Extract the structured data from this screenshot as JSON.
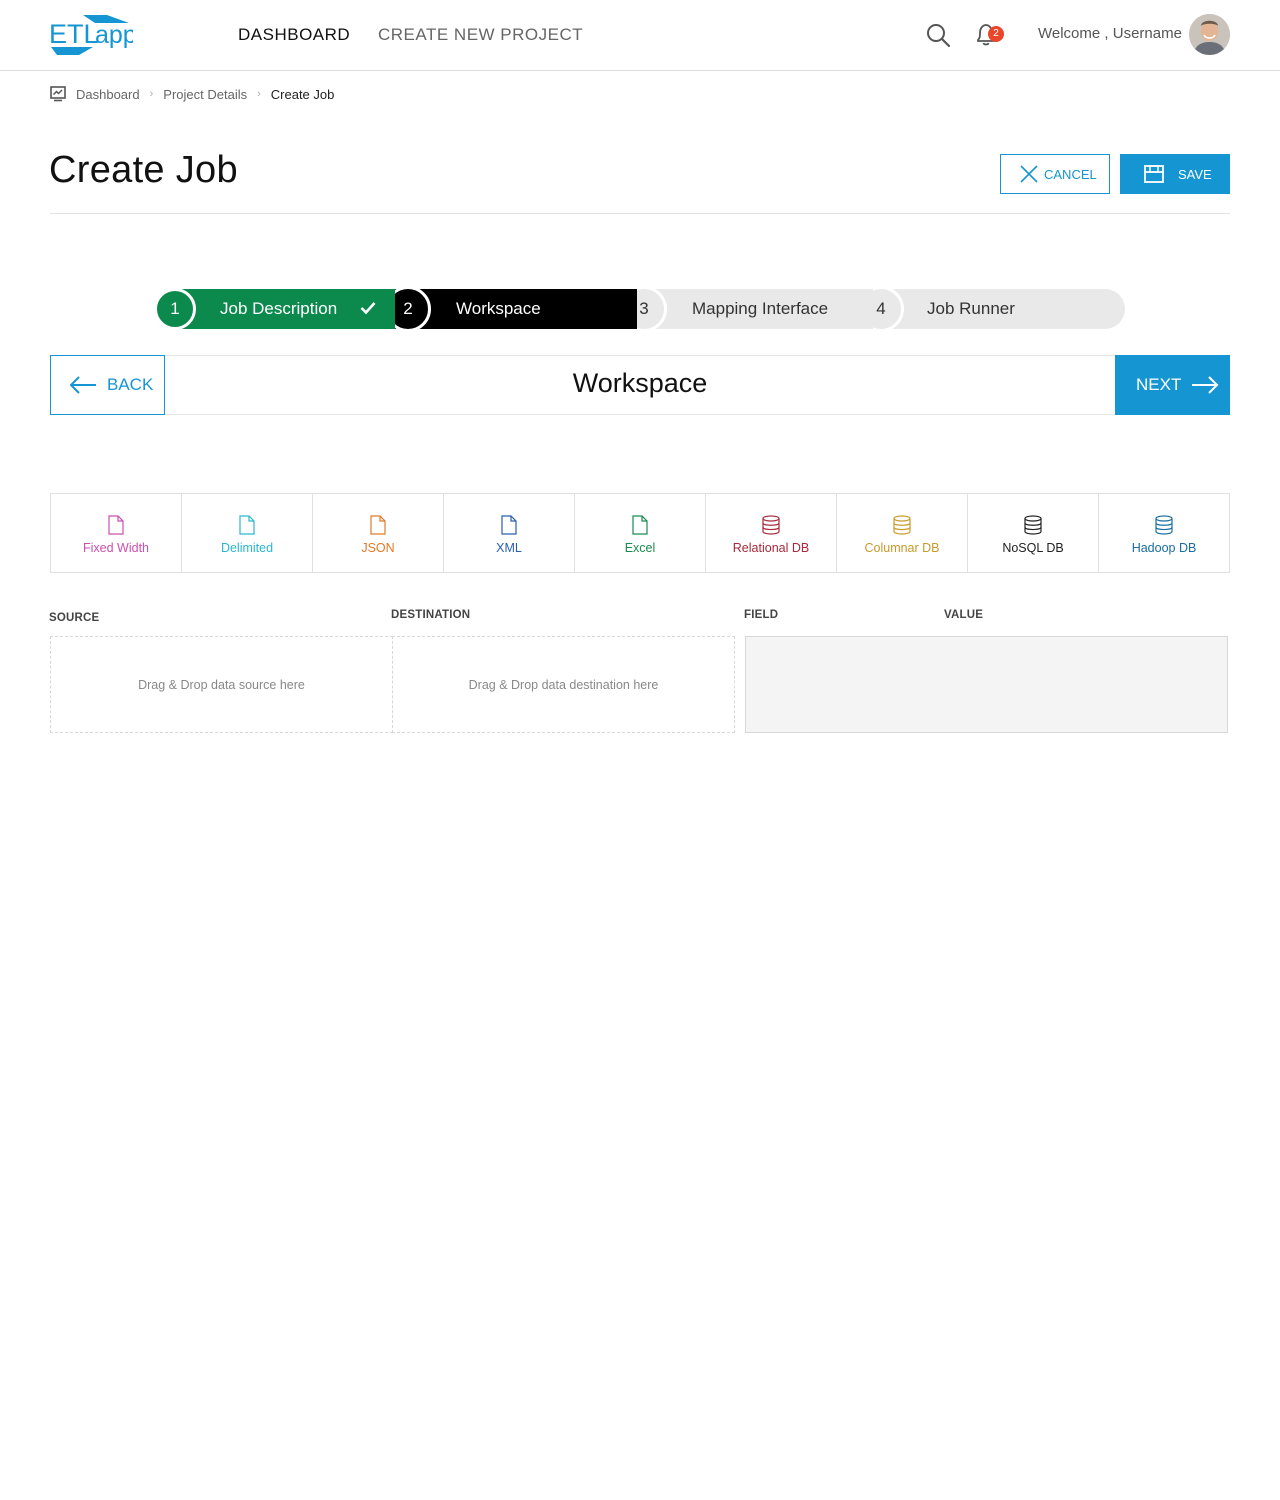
{
  "header": {
    "logo_text": "ETLapp",
    "nav": [
      "DASHBOARD",
      "CREATE NEW PROJECT"
    ],
    "notification_count": "2",
    "welcome": "Welcome , Username",
    "brand_color": "#1596d2"
  },
  "breadcrumb": {
    "items": [
      "Dashboard",
      "Project Details",
      "Create Job"
    ]
  },
  "page": {
    "title": "Create Job",
    "cancel_label": "CANCEL",
    "save_label": "SAVE"
  },
  "stepper": {
    "steps": [
      {
        "num": "1",
        "label": "Job Description",
        "state": "done",
        "color": "#0c8a4e"
      },
      {
        "num": "2",
        "label": "Workspace",
        "state": "active",
        "color": "#000000"
      },
      {
        "num": "3",
        "label": "Mapping Interface",
        "state": "pending",
        "color": "#e9e9e9"
      },
      {
        "num": "4",
        "label": "Job Runner",
        "state": "pending",
        "color": "#e9e9e9"
      }
    ]
  },
  "workspace": {
    "back_label": "BACK",
    "title": "Workspace",
    "next_label": "NEXT"
  },
  "palette": [
    {
      "label": "Fixed Width",
      "icon": "file-icon",
      "color": "#cc4fb0"
    },
    {
      "label": "Delimited",
      "icon": "file-icon",
      "color": "#2bb6d0"
    },
    {
      "label": "JSON",
      "icon": "file-icon",
      "color": "#e07a2a"
    },
    {
      "label": "XML",
      "icon": "file-icon",
      "color": "#2a5fb0"
    },
    {
      "label": "Excel",
      "icon": "file-icon",
      "color": "#1b8a4e"
    },
    {
      "label": "Relational DB",
      "icon": "database-icon",
      "color": "#a82a3a"
    },
    {
      "label": "Columnar DB",
      "icon": "database-icon",
      "color": "#c89a2a"
    },
    {
      "label": "NoSQL DB",
      "icon": "database-icon",
      "color": "#222222"
    },
    {
      "label": "Hadoop DB",
      "icon": "database-icon",
      "color": "#1a6ea0"
    }
  ],
  "mapping": {
    "source_heading": "SOURCE",
    "destination_heading": "DESTINATION",
    "field_heading": "FIELD",
    "value_heading": "VALUE",
    "source_placeholder": "Drag & Drop data source here",
    "destination_placeholder": "Drag & Drop data destination here"
  }
}
